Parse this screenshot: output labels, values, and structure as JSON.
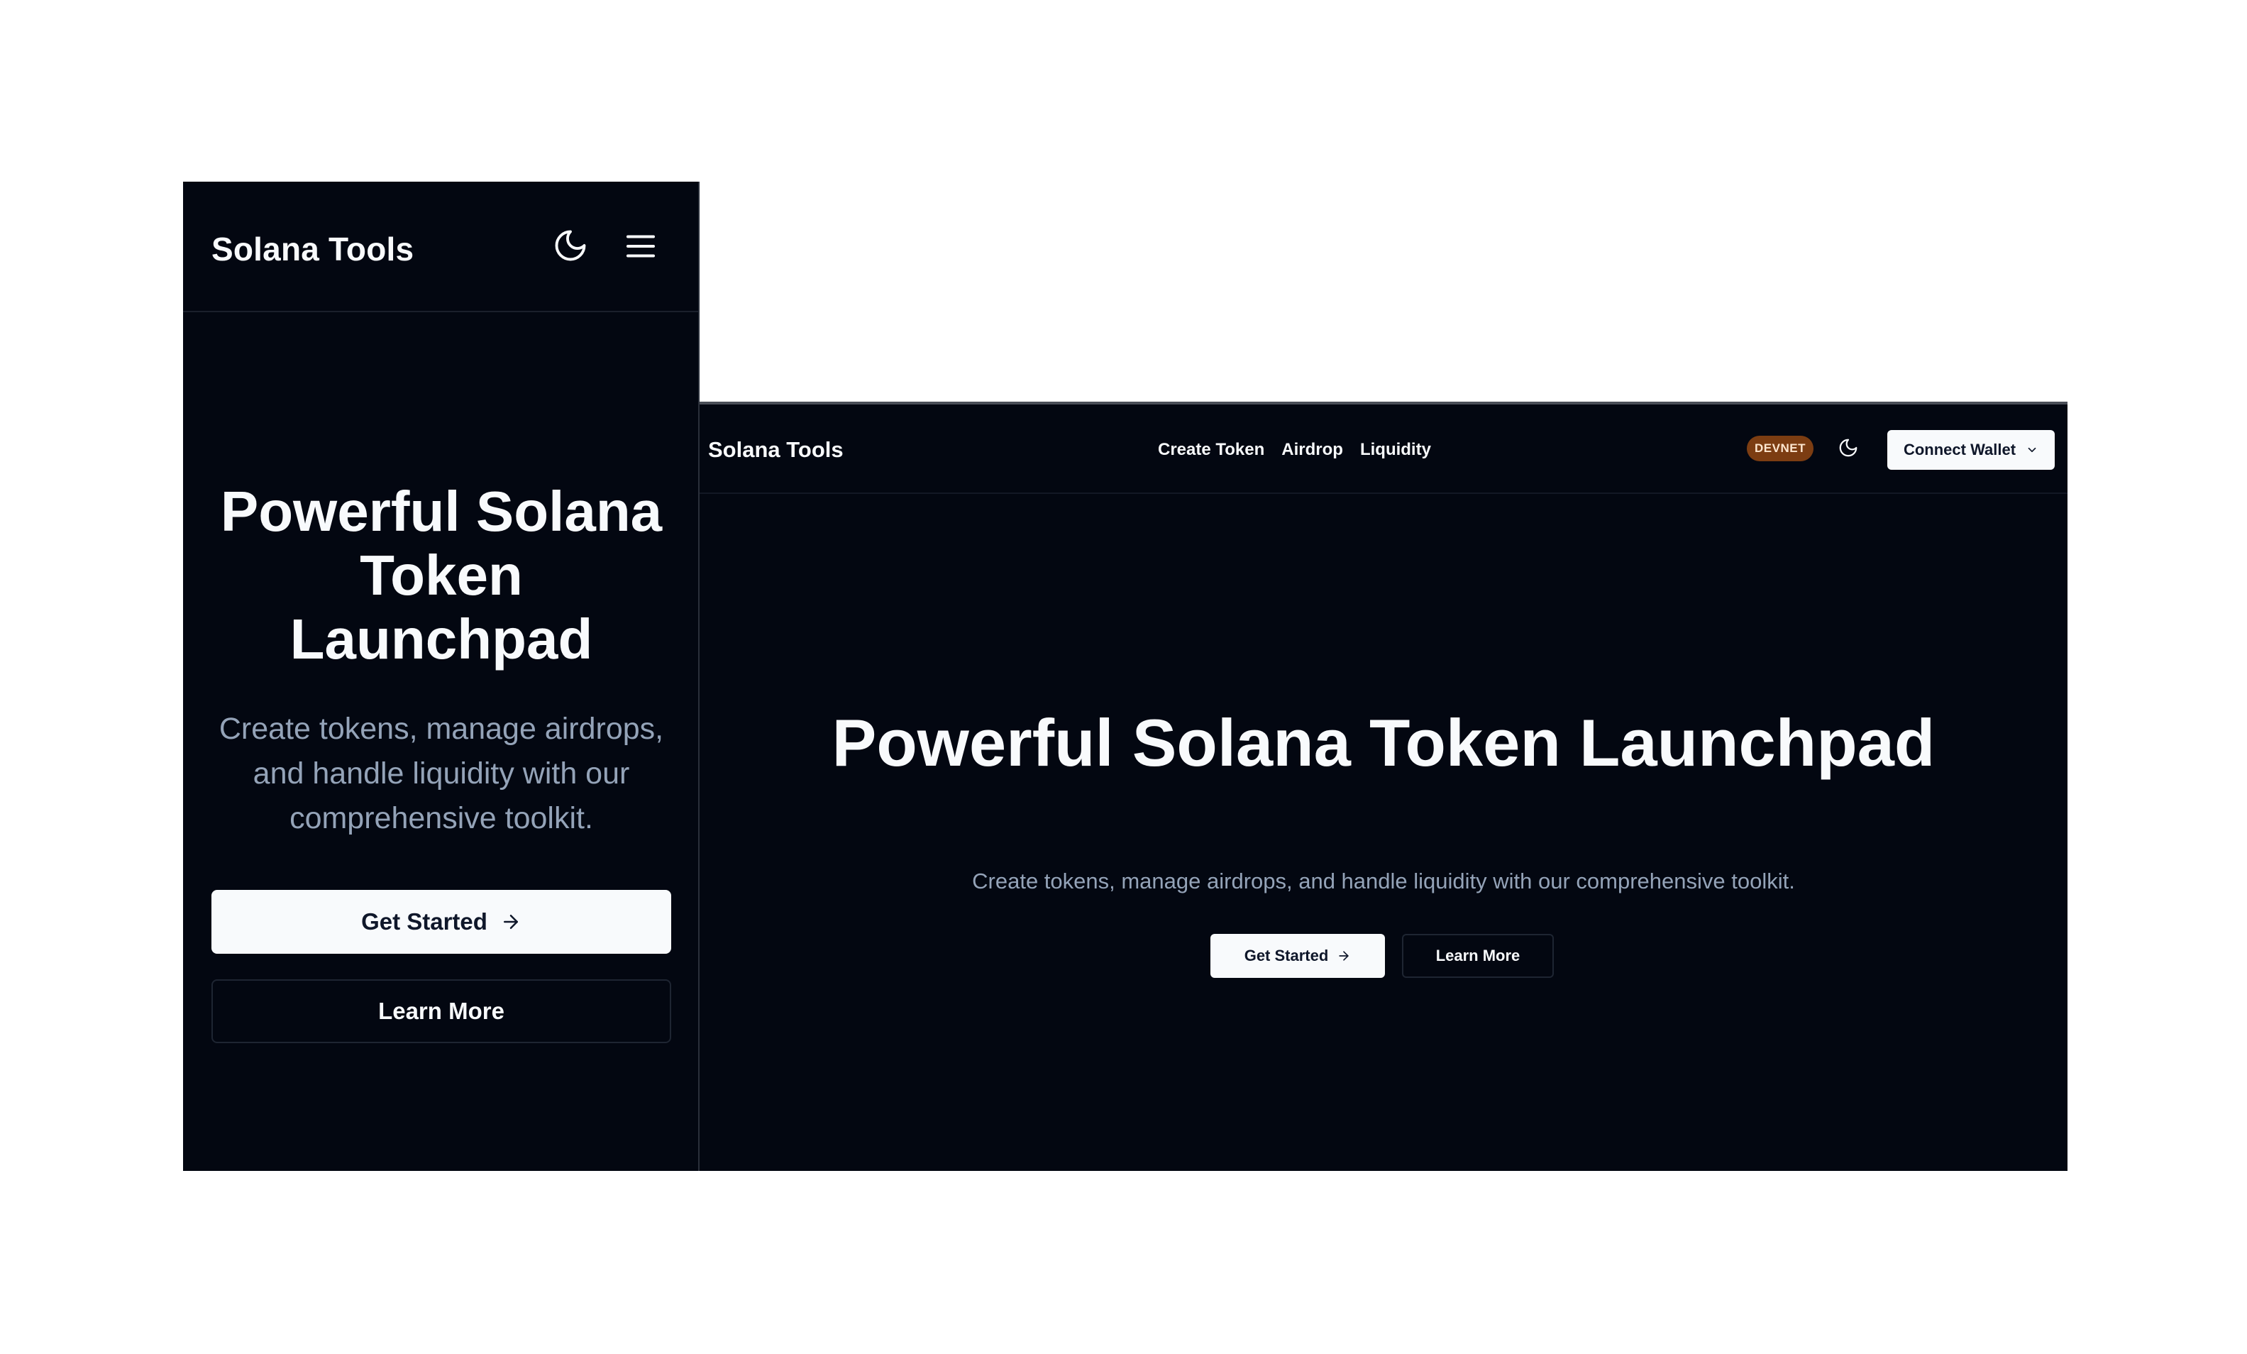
{
  "mobile": {
    "brand": "Solana Tools",
    "icons": {
      "theme": "moon-icon",
      "menu": "hamburger-menu-icon"
    },
    "hero": {
      "title": "Powerful Solana Token Launchpad",
      "subtitle": "Create tokens, manage airdrops, and handle liquidity with our comprehensive toolkit.",
      "primary_button": "Get Started",
      "secondary_button": "Learn More"
    }
  },
  "desktop": {
    "brand": "Solana Tools",
    "nav": [
      "Create Token",
      "Airdrop",
      "Liquidity"
    ],
    "network_badge": "DEVNET",
    "wallet_button": "Connect Wallet",
    "icons": {
      "theme": "moon-icon",
      "wallet_caret": "chevron-down-icon",
      "arrow": "arrow-right-icon"
    },
    "hero": {
      "title": "Powerful Solana Token Launchpad",
      "subtitle": "Create tokens, manage airdrops, and handle liquidity with our comprehensive toolkit.",
      "primary_button": "Get Started",
      "secondary_button": "Learn More"
    }
  },
  "colors": {
    "background": "#030711",
    "foreground": "#f8fafc",
    "muted": "#94a3b8",
    "badge_bg": "#7c3d12",
    "border": "#1e2532"
  }
}
